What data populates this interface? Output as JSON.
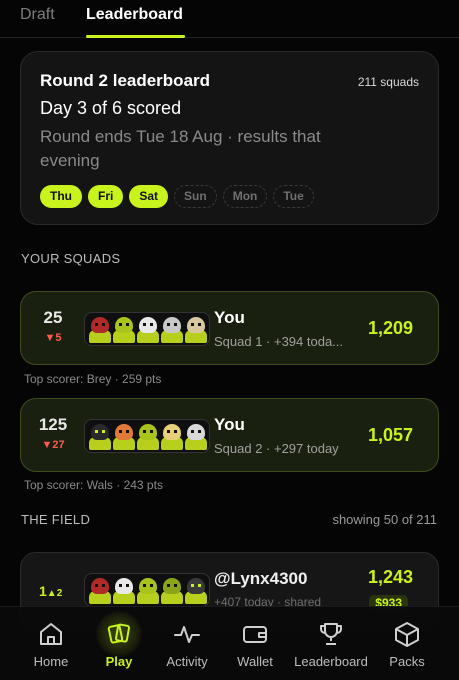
{
  "tabs": {
    "draft": "Draft",
    "leaderboard": "Leaderboard"
  },
  "round": {
    "title": "Round 2 leaderboard",
    "squads": "211 squads",
    "day": "Day 3 of 6 scored",
    "ends": "Round ends Tue 18 Aug · results that evening",
    "days": [
      {
        "label": "Thu",
        "scored": true
      },
      {
        "label": "Fri",
        "scored": true
      },
      {
        "label": "Sat",
        "scored": true
      },
      {
        "label": "Sun",
        "scored": false
      },
      {
        "label": "Mon",
        "scored": false
      },
      {
        "label": "Tue",
        "scored": false
      }
    ]
  },
  "your_squads": {
    "heading": "YOUR SQUADS",
    "items": [
      {
        "rank": "25",
        "delta": "▼5",
        "name": "You",
        "sub": "Squad 1 · +394 toda...",
        "score": "1,209",
        "top_scorer": "Top scorer: Brey · 259 pts"
      },
      {
        "rank": "125",
        "delta": "▼27",
        "name": "You",
        "sub": "Squad 2 · +297 today",
        "score": "1,057",
        "top_scorer": "Top scorer: Wals · 243 pts"
      }
    ]
  },
  "field": {
    "heading": "THE FIELD",
    "showing": "showing 50 of 211",
    "rows": [
      {
        "rank": "1",
        "delta": "▲2",
        "name": "@Lynx4300",
        "sub": "+407 today · shared",
        "score": "1,243",
        "price": "$933"
      }
    ]
  },
  "nav": {
    "items": [
      {
        "label": "Home",
        "icon": "home-icon"
      },
      {
        "label": "Play",
        "icon": "cards-icon",
        "active": true
      },
      {
        "label": "Activity",
        "icon": "activity-icon"
      },
      {
        "label": "Wallet",
        "icon": "wallet-icon"
      },
      {
        "label": "Leaderboard",
        "icon": "trophy-icon"
      },
      {
        "label": "Packs",
        "icon": "box-icon"
      }
    ]
  },
  "colors": {
    "accent": "#c8f31d",
    "down": "#ff5a4f",
    "background": "#050505"
  }
}
